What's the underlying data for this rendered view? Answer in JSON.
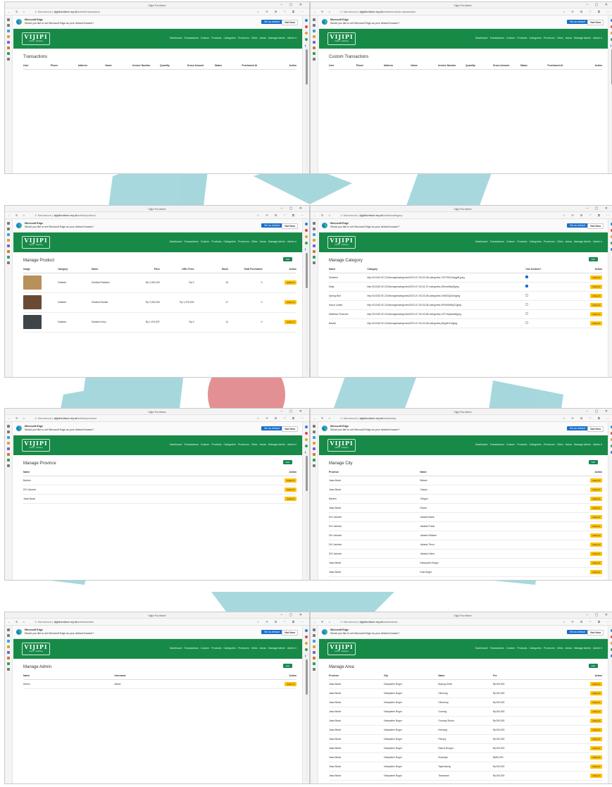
{
  "browser": {
    "window_title": "Vijipi Furniture",
    "not_secure": "Not secure",
    "domain": "vijipifurniture.my.id",
    "infobar_title": "Microsoft Edge",
    "infobar_message": "Would you like to set Microsoft Edge as your default browser?",
    "set_default_label": "Set as default",
    "not_now_label": "Not Now"
  },
  "brand": {
    "logo_text": "VIJIPI",
    "logo_sub": "Home · Inspiring"
  },
  "nav_items": [
    "Dashboard",
    "Transactions",
    "Custom",
    "Products",
    "Categories",
    "Provinces",
    "Cities",
    "Areas",
    "Manage Admin",
    "Admin ▾"
  ],
  "add_label": "Add",
  "action_label": "Action ▾",
  "colors": {
    "nav_green": "#178a48",
    "action_yellow": "#ffc107",
    "add_green": "#198754",
    "edge_blue": "#1b6fc9"
  },
  "transactions": {
    "url_path": "/admin/transaction",
    "title": "Transactions",
    "headers": [
      "User",
      "Phone",
      "Address",
      "Name",
      "Invoice Number",
      "Quantity",
      "Gross Amount",
      "Status",
      "Purchased At",
      "Action"
    ]
  },
  "custom": {
    "url_path": "/admin/custom-transaction",
    "title": "Custom Transactions",
    "headers": [
      "User",
      "Phone",
      "Address",
      "Name",
      "Invoice Number",
      "Quantity",
      "Gross Amount",
      "Status",
      "Purchased At",
      "Action"
    ]
  },
  "products": {
    "url_path": "/admin/product",
    "title": "Manage Product",
    "headers": [
      "Image",
      "Category",
      "Name",
      "Price",
      "Offer Price",
      "Stock",
      "Total Purchased",
      "Action"
    ],
    "rows": [
      {
        "category": "Sofabed",
        "name": "Sofabed Rabbino",
        "price": "Rp 2,000,000",
        "offer": "Rp 0",
        "stock": "15",
        "purchased": "0",
        "img": "#b8905a"
      },
      {
        "category": "Sofabed",
        "name": "Sofabed Bonita",
        "price": "Rp 2,000,000",
        "offer": "Rp 1,975,000",
        "stock": "17",
        "purchased": "0",
        "img": "#6b4a35"
      },
      {
        "category": "Sofabed",
        "name": "Sofabed Jess",
        "price": "Rp 1,974,997",
        "offer": "Rp 0",
        "stock": "11",
        "purchased": "0",
        "img": "#3f4448"
      }
    ]
  },
  "categories": {
    "url_path": "/admin/category",
    "title": "Manage Category",
    "headers": [
      "Name",
      "Category",
      "Can Custom?",
      "Action"
    ],
    "rows": [
      {
        "name": "Sofabed",
        "file": "http://103.82.92.213/storage/categories/2023-07-03-02-08-categories-Y5YT6OXmkgjvfLjpeg",
        "custom": true
      },
      {
        "name": "Meja",
        "file": "http://103.82.92.213/storage/categories/2023-07-03-02-37-categories-Z5nlnxMkpEjpeg",
        "custom": true
      },
      {
        "name": "Spring Bed",
        "file": "http://103.82.92.213/storage/categories/2023-07-03-03-08-categories-VrMO0QaGmjpeg",
        "custom": false
      },
      {
        "name": "Kasur Lantai",
        "file": "http://103.82.92.213/storage/categories/2023-07-03-03-08-categories-NFhU9N6hjZOjpeg",
        "custom": false
      },
      {
        "name": "Mattress Protector",
        "file": "http://103.82.92.213/storage/categories/2023-07-03-03-08-categories-XZTYaqAwwktjpeg",
        "custom": false
      },
      {
        "name": "Bantal",
        "file": "http://103.82.92.213/storage/categories/2023-07-03-03-08-categories-jWrjyBJ1Uljpeg",
        "custom": false
      }
    ]
  },
  "provinces": {
    "url_path": "/admin/province",
    "title": "Manage Province",
    "headers": [
      "Name",
      "Action"
    ],
    "rows": [
      "Banten",
      "DKI Jakarta",
      "Jawa Barat"
    ]
  },
  "cities": {
    "url_path": "/admin/city",
    "title": "Manage City",
    "headers": [
      "Province",
      "Name",
      "Action"
    ],
    "rows": [
      [
        "Jawa Barat",
        "Bekasi"
      ],
      [
        "Jawa Barat",
        "Cianjur"
      ],
      [
        "Banten",
        "Cilegon"
      ],
      [
        "Jawa Barat",
        "Depok"
      ],
      [
        "DKI Jakarta",
        "Jakarta Barat"
      ],
      [
        "DKI Jakarta",
        "Jakarta Pusat"
      ],
      [
        "DKI Jakarta",
        "Jakarta Selatan"
      ],
      [
        "DKI Jakarta",
        "Jakarta Timur"
      ],
      [
        "DKI Jakarta",
        "Jakarta Utara"
      ],
      [
        "Jawa Barat",
        "Kabupaten Bogor"
      ],
      [
        "Jawa Barat",
        "Kota Bogor"
      ]
    ]
  },
  "admins": {
    "url_path": "/admin/admin",
    "title": "Manage Admin",
    "headers": [
      "Name",
      "Username",
      "Action"
    ],
    "rows": [
      [
        "Admin",
        "admin"
      ]
    ]
  },
  "areas": {
    "url_path": "/admin/area",
    "title": "Manage Area",
    "headers": [
      "Province",
      "City",
      "Name",
      "Fee",
      "Action"
    ],
    "rows": [
      [
        "Jawa Barat",
        "Kabupaten Bogor",
        "Bojong Gede",
        "Rp150,000"
      ],
      [
        "Jawa Barat",
        "Kabupaten Bogor",
        "Cibinong",
        "Rp150,000"
      ],
      [
        "Jawa Barat",
        "Kabupaten Bogor",
        "Citeureup",
        "Rp150,000"
      ],
      [
        "Jawa Barat",
        "Kabupaten Bogor",
        "Gunung",
        "Rp150,000"
      ],
      [
        "Jawa Barat",
        "Kabupaten Bogor",
        "Gunung Sindur",
        "Rp150,000"
      ],
      [
        "Jawa Barat",
        "Kabupaten Bogor",
        "Kemang",
        "Rp150,000"
      ],
      [
        "Jawa Barat",
        "Kabupaten Bogor",
        "Parung",
        "Rp150,000"
      ],
      [
        "Jawa Barat",
        "Kabupaten Bogor",
        "Ranca Bungur",
        "Rp150,000"
      ],
      [
        "Jawa Barat",
        "Kabupaten Bogor",
        "Sukaraja",
        "Rp80,000"
      ],
      [
        "Jawa Barat",
        "Kabupaten Bogor",
        "Tajurhalang",
        "Rp150,000"
      ],
      [
        "Jawa Barat",
        "Kabupaten Bogor",
        "Tamansari",
        "Rp150,000"
      ]
    ]
  }
}
